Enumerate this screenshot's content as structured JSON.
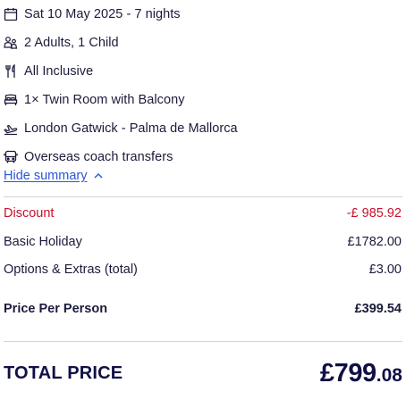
{
  "details": [
    {
      "icon": "calendar-icon",
      "text": "Sat 10 May 2025 - 7 nights"
    },
    {
      "icon": "guests-icon",
      "text": "2 Adults, 1 Child"
    },
    {
      "icon": "cutlery-icon",
      "text": "All Inclusive"
    },
    {
      "icon": "bed-icon",
      "text": "1× Twin Room with Balcony"
    },
    {
      "icon": "plane-icon",
      "text": "London Gatwick - Palma de Mallorca"
    },
    {
      "icon": "bus-icon",
      "text": "Overseas coach transfers"
    }
  ],
  "summary_toggle": {
    "label": "Hide summary",
    "icon": "chevron-up-icon"
  },
  "price_lines": [
    {
      "label": "Discount",
      "value": "-£ 985.92",
      "color": "#c8102e"
    },
    {
      "label": "Basic Holiday",
      "value": "£1782.00"
    },
    {
      "label": "Options & Extras (total)",
      "value": "£3.00"
    },
    {
      "label": "Price Per Person",
      "value": "£399.54"
    }
  ],
  "total": {
    "label": "TOTAL PRICE",
    "amount_main": "£799",
    "amount_decimal": ".08"
  },
  "colors": {
    "text": "#1b1b3b",
    "link": "#2a56d6",
    "discount": "#c8102e",
    "total": "#101046",
    "divider": "#d3d3d9"
  }
}
